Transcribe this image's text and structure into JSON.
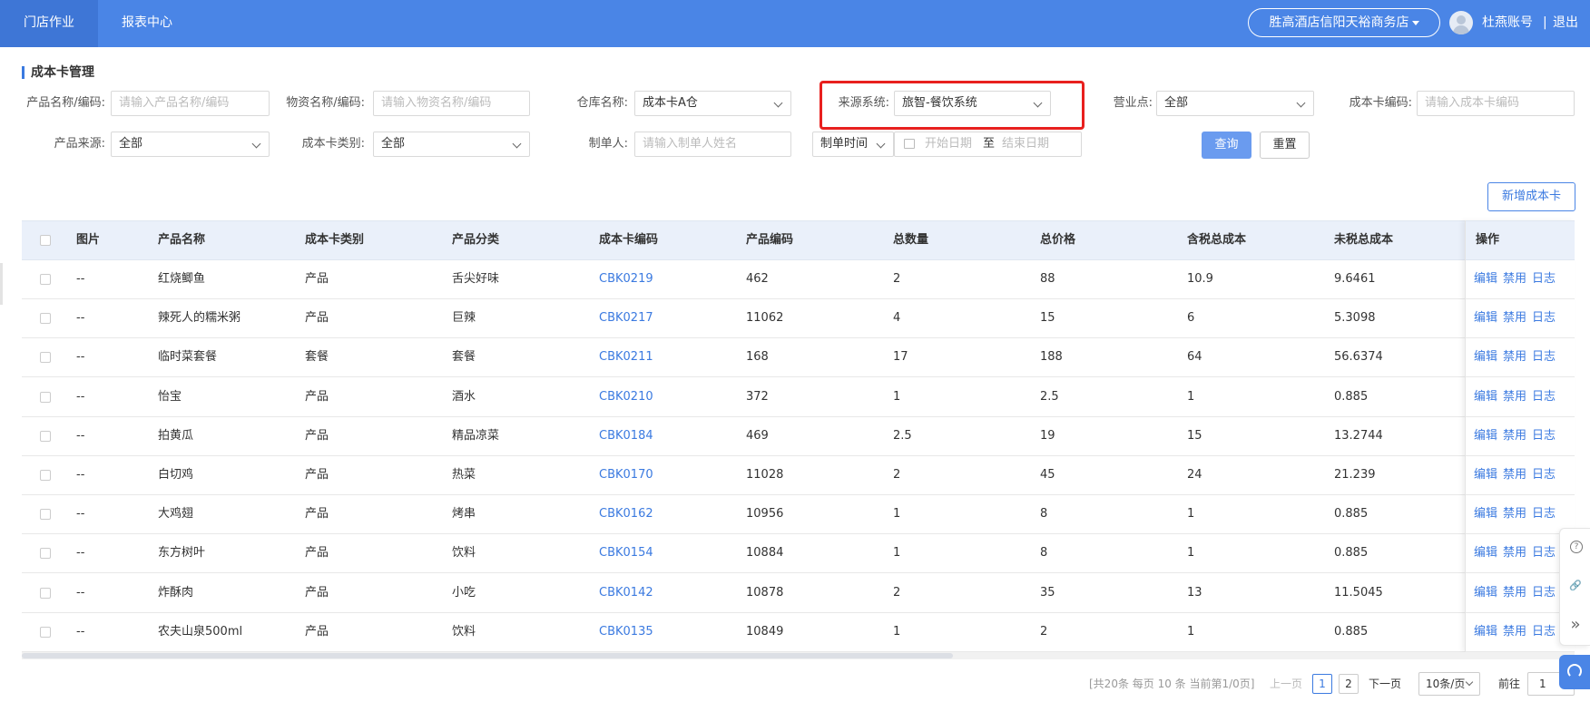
{
  "topnav": {
    "tabs": [
      {
        "label": "门店作业",
        "active": true
      },
      {
        "label": "报表中心",
        "active": false
      }
    ],
    "store_selector": "胜高酒店信阳天裕商务店",
    "user_name": "杜燕账号",
    "separator": "|",
    "logout": "退出"
  },
  "page": {
    "title": "成本卡管理"
  },
  "filters": {
    "product_name": {
      "label": "产品名称/编码:",
      "placeholder": "请输入产品名称/编码"
    },
    "material_name": {
      "label": "物资名称/编码:",
      "placeholder": "请输入物资名称/编码"
    },
    "warehouse": {
      "label": "仓库名称:",
      "value": "成本卡A仓"
    },
    "source_system": {
      "label": "来源系统:",
      "value": "旅智-餐饮系统"
    },
    "sales_point": {
      "label": "营业点:",
      "value": "全部"
    },
    "card_code": {
      "label": "成本卡编码:",
      "placeholder": "请输入成本卡编码"
    },
    "product_source": {
      "label": "产品来源:",
      "value": "全部"
    },
    "card_category": {
      "label": "成本卡类别:",
      "value": "全部"
    },
    "creator": {
      "label": "制单人:",
      "placeholder": "请输入制单人姓名"
    },
    "time_type": {
      "value": "制单时间"
    },
    "date_range": {
      "start_placeholder": "开始日期",
      "to": "至",
      "end_placeholder": "结束日期"
    },
    "query_button": "查询",
    "reset_button": "重置"
  },
  "actions": {
    "add_button": "新增成本卡"
  },
  "table": {
    "columns": [
      "图片",
      "产品名称",
      "成本卡类别",
      "产品分类",
      "成本卡编码",
      "产品编码",
      "总数量",
      "总价格",
      "含税总成本",
      "未税总成本",
      "操作"
    ],
    "row_actions": [
      "编辑",
      "禁用",
      "日志"
    ],
    "rows": [
      {
        "image": "--",
        "name": "红烧鲫鱼",
        "category": "产品",
        "classify": "舌尖好味",
        "card_code": "CBK0219",
        "product_code": "462",
        "qty": "2",
        "price": "88",
        "tax_cost": "10.9",
        "notax_cost": "9.6461"
      },
      {
        "image": "--",
        "name": "辣死人的糯米粥",
        "category": "产品",
        "classify": "巨辣",
        "card_code": "CBK0217",
        "product_code": "11062",
        "qty": "4",
        "price": "15",
        "tax_cost": "6",
        "notax_cost": "5.3098"
      },
      {
        "image": "--",
        "name": "临时菜套餐",
        "category": "套餐",
        "classify": "套餐",
        "card_code": "CBK0211",
        "product_code": "168",
        "qty": "17",
        "price": "188",
        "tax_cost": "64",
        "notax_cost": "56.6374"
      },
      {
        "image": "--",
        "name": "怡宝",
        "category": "产品",
        "classify": "酒水",
        "card_code": "CBK0210",
        "product_code": "372",
        "qty": "1",
        "price": "2.5",
        "tax_cost": "1",
        "notax_cost": "0.885"
      },
      {
        "image": "--",
        "name": "拍黄瓜",
        "category": "产品",
        "classify": "精品凉菜",
        "card_code": "CBK0184",
        "product_code": "469",
        "qty": "2.5",
        "price": "19",
        "tax_cost": "15",
        "notax_cost": "13.2744"
      },
      {
        "image": "--",
        "name": "白切鸡",
        "category": "产品",
        "classify": "热菜",
        "card_code": "CBK0170",
        "product_code": "11028",
        "qty": "2",
        "price": "45",
        "tax_cost": "24",
        "notax_cost": "21.239"
      },
      {
        "image": "--",
        "name": "大鸡翅",
        "category": "产品",
        "classify": "烤串",
        "card_code": "CBK0162",
        "product_code": "10956",
        "qty": "1",
        "price": "8",
        "tax_cost": "1",
        "notax_cost": "0.885"
      },
      {
        "image": "--",
        "name": "东方树叶",
        "category": "产品",
        "classify": "饮料",
        "card_code": "CBK0154",
        "product_code": "10884",
        "qty": "1",
        "price": "8",
        "tax_cost": "1",
        "notax_cost": "0.885"
      },
      {
        "image": "--",
        "name": "炸酥肉",
        "category": "产品",
        "classify": "小吃",
        "card_code": "CBK0142",
        "product_code": "10878",
        "qty": "2",
        "price": "35",
        "tax_cost": "13",
        "notax_cost": "11.5045"
      },
      {
        "image": "--",
        "name": "农夫山泉500ml",
        "category": "产品",
        "classify": "饮料",
        "card_code": "CBK0135",
        "product_code": "10849",
        "qty": "1",
        "price": "2",
        "tax_cost": "1",
        "notax_cost": "0.885"
      }
    ]
  },
  "pagination": {
    "info": "[共20条 每页 10 条 当前第1/0页]",
    "prev": "上一页",
    "pages": [
      "1",
      "2"
    ],
    "current": "1",
    "next": "下一页",
    "page_size": "10条/页",
    "goto_label": "前往",
    "goto_value": "1"
  },
  "side_tools": {
    "help": "?",
    "link": "🔗",
    "collapse": "»"
  },
  "colors": {
    "primary": "#4a85e6",
    "link": "#3b7ae0",
    "highlight": "#e8201e"
  }
}
